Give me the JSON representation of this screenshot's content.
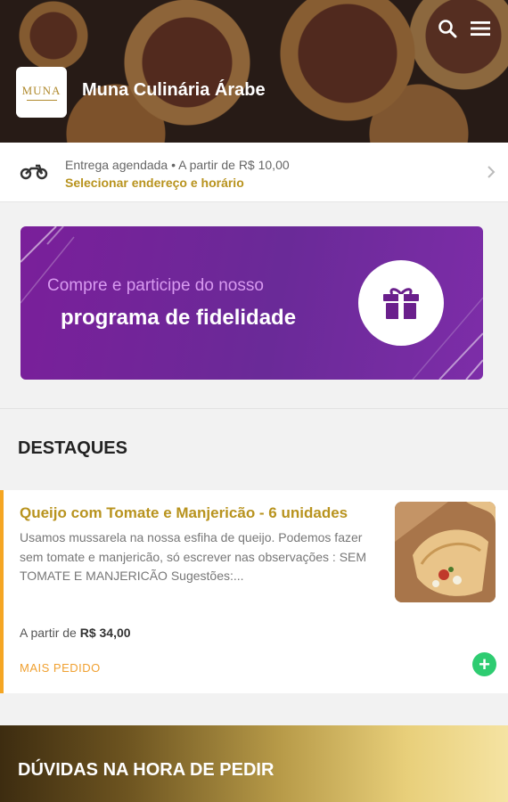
{
  "header": {
    "store_name": "Muna Culinária Árabe",
    "logo_text": "MUNA"
  },
  "delivery": {
    "line1": "Entrega agendada  •  A partir de R$ 10,00",
    "action": "Selecionar endereço e horário"
  },
  "loyalty_banner": {
    "line1": "Compre e participe do nosso",
    "line2": "programa de fidelidade"
  },
  "highlights": {
    "title": "DESTAQUES",
    "items": [
      {
        "name": "Queijo com Tomate e Manjericão - 6 unidades",
        "description": "Usamos mussarela na nossa esfiha de queijo. Podemos fazer sem tomate e manjericão, só escrever nas observações : SEM TOMATE E MANJERICÃO Sugestões:...",
        "price_prefix": "A partir de",
        "price": "R$ 34,00",
        "badge": "MAIS PEDIDO"
      }
    ]
  },
  "faq": {
    "title": "DÚVIDAS NA HORA DE PEDIR"
  },
  "colors": {
    "accent_gold": "#b8931e",
    "badge_orange": "#f0a030",
    "banner_purple": "#7a1f9a",
    "add_green": "#2ecc71"
  },
  "icons": [
    "search-icon",
    "menu-icon",
    "motorcycle-icon",
    "chevron-right-icon",
    "gift-icon",
    "plus-icon"
  ]
}
